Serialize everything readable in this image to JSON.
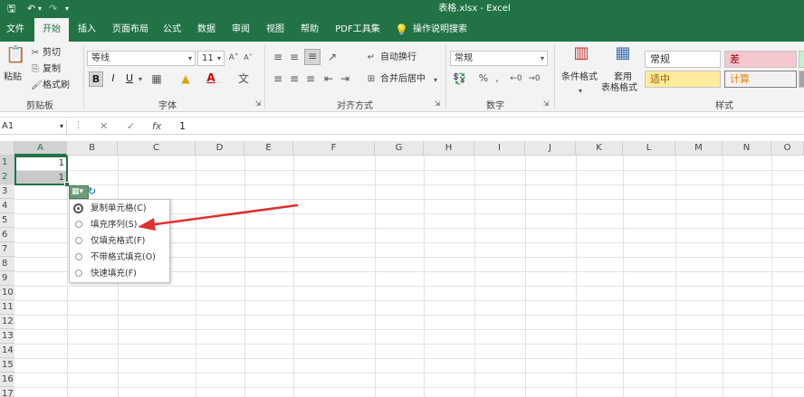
{
  "titlebar": {
    "title": "表格.xlsx - Excel",
    "save_icon": "save-icon",
    "undo_icon": "undo-icon",
    "redo_icon": "redo-icon"
  },
  "tabs": [
    {
      "label": "文件"
    },
    {
      "label": "开始"
    },
    {
      "label": "插入"
    },
    {
      "label": "页面布局"
    },
    {
      "label": "公式"
    },
    {
      "label": "数据"
    },
    {
      "label": "审阅"
    },
    {
      "label": "视图"
    },
    {
      "label": "帮助"
    },
    {
      "label": "PDF工具集"
    }
  ],
  "tell_me": "操作说明搜索",
  "ribbon": {
    "clipboard": {
      "paste": "粘贴",
      "cut": "剪切",
      "copy": "复制",
      "format_painter": "格式刷",
      "label": "剪贴板"
    },
    "font": {
      "name": "等线",
      "size": "11",
      "label": "字体",
      "bold": "B",
      "italic": "I",
      "underline": "U"
    },
    "alignment": {
      "wrap": "自动换行",
      "merge": "合并后居中",
      "label": "对齐方式"
    },
    "number": {
      "format": "常规",
      "percent": "%",
      "comma": ",",
      "label": "数字"
    },
    "styles": {
      "cond_format": "条件格式",
      "table_format_1": "套用",
      "table_format_2": "表格格式",
      "label": "样式",
      "normal": "常规",
      "bad": "差",
      "neutral": "适中",
      "calc": "计算"
    }
  },
  "formula": {
    "namebox": "A1",
    "fx": "fx",
    "value": "1"
  },
  "columns": [
    "A",
    "B",
    "C",
    "D",
    "E",
    "F",
    "G",
    "H",
    "I",
    "J",
    "K",
    "L",
    "M",
    "N",
    "O"
  ],
  "rows": [
    "1",
    "2",
    "3",
    "4",
    "5",
    "6",
    "7",
    "8",
    "9",
    "10",
    "11",
    "12",
    "13",
    "14",
    "15",
    "16",
    "17"
  ],
  "cells": {
    "a1": "1",
    "a2": "1"
  },
  "autofill": {
    "options": [
      {
        "label": "复制单元格(C)"
      },
      {
        "label": "填充序列(S)"
      },
      {
        "label": "仅填充格式(F)"
      },
      {
        "label": "不带格式填充(O)"
      },
      {
        "label": "快速填充(F)"
      }
    ]
  },
  "colors": {
    "excel_green": "#217346",
    "arrow": "#e03030"
  }
}
